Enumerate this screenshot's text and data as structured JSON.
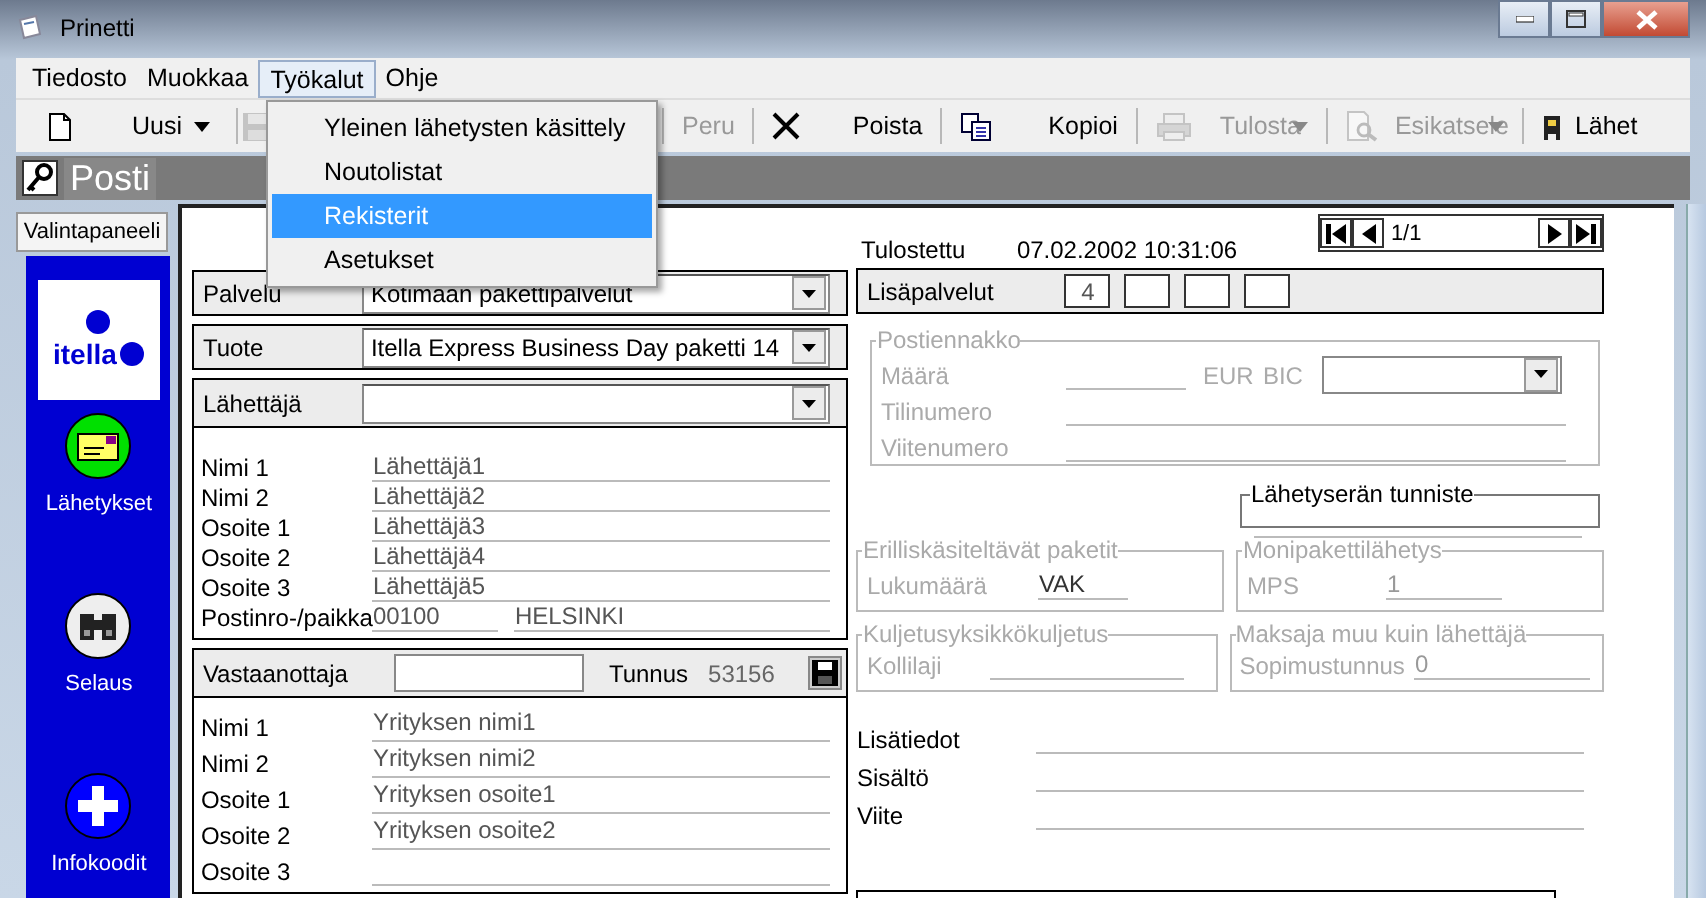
{
  "window": {
    "title": "Prinetti"
  },
  "menu": [
    {
      "label": "Tiedosto",
      "selected": false
    },
    {
      "label": "Muokkaa",
      "selected": false
    },
    {
      "label": "Työkalut",
      "selected": true
    },
    {
      "label": "Ohje",
      "selected": false
    }
  ],
  "dropdown": [
    {
      "label": "Yleinen lähetysten käsittely",
      "selected": false
    },
    {
      "label": "Noutolistat",
      "selected": false
    },
    {
      "label": "Rekisterit",
      "selected": true
    },
    {
      "label": "Asetukset",
      "selected": false
    }
  ],
  "toolbar": [
    {
      "kind": "new",
      "label": "Uusi",
      "caret": true,
      "disabled": false
    },
    {
      "kind": "save",
      "disabled": true
    },
    {
      "kind": "undo",
      "label": "Peru",
      "disabled": true
    },
    {
      "kind": "delete",
      "label": "Poista",
      "disabled": false
    },
    {
      "kind": "copy",
      "label": "Kopioi",
      "disabled": false
    },
    {
      "kind": "print",
      "label": "Tulosta",
      "caret": true,
      "disabled": true
    },
    {
      "kind": "preview",
      "label": "Esikatsele",
      "caret": true,
      "disabled": true
    },
    {
      "kind": "send",
      "label": "Lähet",
      "disabled": false
    }
  ],
  "section_title": "Posti",
  "sidebar": {
    "tab": "Valintapaneeli",
    "logo": "itella",
    "items": [
      {
        "kind": "mail",
        "label": "Lähetykset"
      },
      {
        "kind": "binoculars",
        "label": "Selaus"
      },
      {
        "kind": "plus",
        "label": "Infokoodit"
      }
    ]
  },
  "service": {
    "label": "Palvelu",
    "value": "Kotimaan pakettipalvelut"
  },
  "product": {
    "label": "Tuote",
    "value": "Itella Express Business Day paketti 14"
  },
  "sender": {
    "label": "Lähettäjä",
    "fields": [
      {
        "label": "Nimi 1",
        "value": "Lähettäjä1"
      },
      {
        "label": "Nimi 2",
        "value": "Lähettäjä2"
      },
      {
        "label": "Osoite 1",
        "value": "Lähettäjä3"
      },
      {
        "label": "Osoite 2",
        "value": "Lähettäjä4"
      },
      {
        "label": "Osoite 3",
        "value": "Lähettäjä5"
      }
    ],
    "postal": {
      "label": "Postinro-/paikka",
      "code": "00100",
      "city": "HELSINKI"
    }
  },
  "recipient": {
    "label": "Vastaanottaja",
    "id_label": "Tunnus",
    "id_value": "53156",
    "fields": [
      {
        "label": "Nimi 1",
        "value": "Yrityksen nimi1"
      },
      {
        "label": "Nimi 2",
        "value": "Yrityksen nimi2"
      },
      {
        "label": "Osoite 1",
        "value": "Yrityksen osoite1"
      },
      {
        "label": "Osoite 2",
        "value": "Yrityksen osoite2"
      },
      {
        "label": "Osoite 3"
      }
    ]
  },
  "printed": {
    "label": "Tulostettu",
    "value": "07.02.2002 10:31:06"
  },
  "pager": {
    "value": "1/1"
  },
  "extra_services": {
    "label": "Lisäpalvelut",
    "codes": [
      {
        "kind": "code",
        "value": "4"
      },
      {
        "kind": "empty"
      },
      {
        "kind": "empty"
      },
      {
        "kind": "empty"
      }
    ]
  },
  "cod": {
    "title": "Postiennakko",
    "disabled": true,
    "amount_label": "Määrä",
    "currency": "EUR",
    "bic_label": "BIC",
    "account_label": "Tilinumero",
    "reference_label": "Viitenumero"
  },
  "batch": {
    "title": "Lähetyserän tunniste",
    "disabled": false
  },
  "special": {
    "title": "Erilliskäsiteltävät paketit",
    "disabled": true,
    "label": "Lukumäärä",
    "value": "VAK"
  },
  "multi": {
    "title": "Monipakettilähetys",
    "disabled": true,
    "label": "MPS",
    "value": "1"
  },
  "unit": {
    "title": "Kuljetusyksikkökuljetus",
    "disabled": true,
    "label": "Kollilaji"
  },
  "payer": {
    "title": "Maksaja muu kuin lähettäjä",
    "disabled": true,
    "label": "Sopimustunnus",
    "value": "0"
  },
  "notes": [
    {
      "label": "Lisätiedot"
    },
    {
      "label": "Sisältö"
    },
    {
      "label": "Viite"
    }
  ]
}
